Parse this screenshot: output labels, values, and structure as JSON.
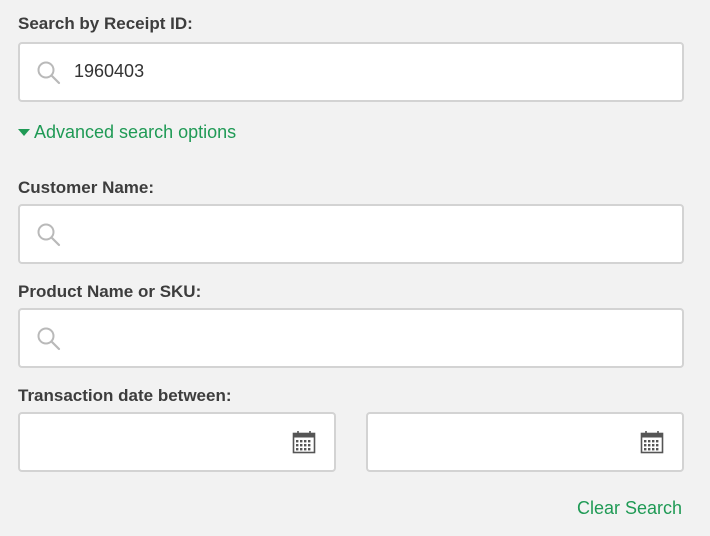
{
  "receipt_search": {
    "label": "Search by Receipt ID:",
    "value": "1960403",
    "icon": "search-icon"
  },
  "advanced_toggle": {
    "label": "Advanced search options",
    "icon": "caret-down-icon",
    "color": "#1f9a55"
  },
  "customer_search": {
    "label": "Customer Name:",
    "value": "",
    "icon": "search-icon"
  },
  "product_search": {
    "label": "Product Name or SKU:",
    "value": "",
    "icon": "search-icon"
  },
  "date_range": {
    "label": "Transaction date between:",
    "start_value": "",
    "end_value": "",
    "icon": "calendar-icon"
  },
  "actions": {
    "clear_label": "Clear Search"
  },
  "colors": {
    "background": "#f2f2f2",
    "field_border": "#d3d3d3",
    "accent": "#1f9a55",
    "label_text": "#3d3d3d"
  }
}
